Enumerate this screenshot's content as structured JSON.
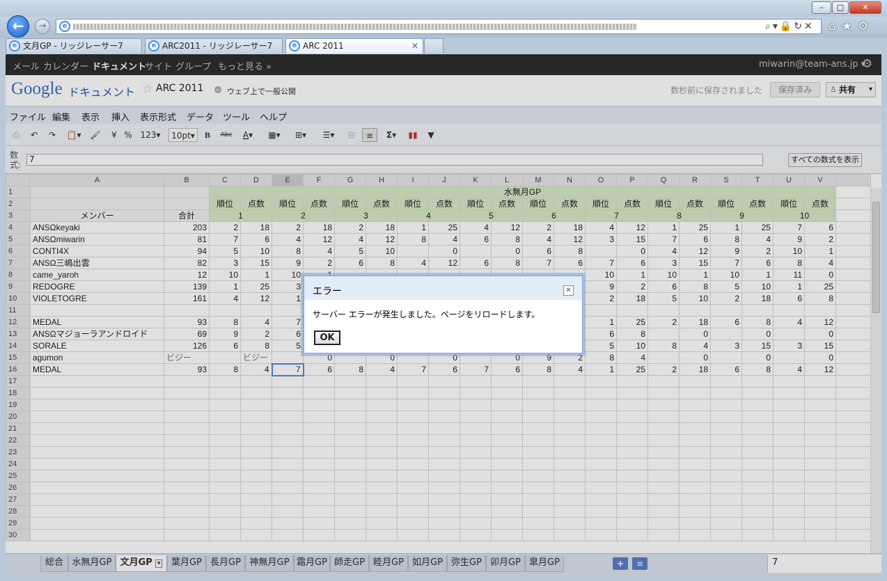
{
  "browser": {
    "tabs": [
      {
        "label": "文月GP - リッジレーサー7",
        "active": false
      },
      {
        "label": "ARC2011 - リッジレーサー7",
        "active": false
      },
      {
        "label": "ARC 2011",
        "active": true
      }
    ]
  },
  "gbar": {
    "items": [
      "メール",
      "カレンダー",
      "ドキュメント",
      "サイト",
      "グループ",
      "もっと見る »"
    ],
    "account": "miwarin@team-ans.jp ▾"
  },
  "header": {
    "logo": "Google",
    "product": "ドキュメント",
    "doc_title": "ARC 2011",
    "visibility": "ウェブ上で一般公開",
    "save_status": "数秒前に保存されました",
    "saved_button": "保存済み",
    "share_button": "共有"
  },
  "menu": [
    "ファイル",
    "編集",
    "表示",
    "挿入",
    "表示形式",
    "データ",
    "ツール",
    "ヘルプ"
  ],
  "toolbar": {
    "currency": "¥",
    "percent": "%",
    "format": "123",
    "font_size": "10pt",
    "bold": "B",
    "strike": "Abc"
  },
  "formula": {
    "label_line1": "数",
    "label_line2": "式:",
    "value": "7",
    "show_all_button": "すべての数式を表示"
  },
  "sheet": {
    "columns": [
      "A",
      "B",
      "C",
      "D",
      "E",
      "F",
      "G",
      "H",
      "I",
      "J",
      "K",
      "L",
      "M",
      "N",
      "O",
      "P",
      "Q",
      "R",
      "S",
      "T",
      "U",
      "V"
    ],
    "group_title": "水無月GP",
    "rank_label": "順位",
    "points_label": "点数",
    "round_numbers": [
      "1",
      "2",
      "3",
      "4",
      "5",
      "6",
      "7",
      "8",
      "9",
      "10"
    ],
    "member_header": "メンバー",
    "total_header": "合計",
    "rows": [
      {
        "n": "4",
        "name": "ANSΩkeyaki",
        "total": "203",
        "vals": [
          "2",
          "18",
          "2",
          "18",
          "2",
          "18",
          "1",
          "25",
          "4",
          "12",
          "2",
          "18",
          "4",
          "12",
          "1",
          "25",
          "1",
          "25",
          "7",
          "6"
        ]
      },
      {
        "n": "5",
        "name": "ANSΩmiwarin",
        "total": "81",
        "vals": [
          "7",
          "6",
          "4",
          "12",
          "4",
          "12",
          "8",
          "4",
          "6",
          "8",
          "4",
          "12",
          "3",
          "15",
          "7",
          "6",
          "8",
          "4",
          "9",
          "2"
        ]
      },
      {
        "n": "6",
        "name": "CONTI4X",
        "total": "94",
        "vals": [
          "5",
          "10",
          "8",
          "4",
          "5",
          "10",
          "",
          "0",
          "",
          "0",
          "6",
          "8",
          "",
          "0",
          "4",
          "12",
          "9",
          "2",
          "10",
          "1"
        ]
      },
      {
        "n": "7",
        "name": "ANSΩ三嶋出雲",
        "total": "82",
        "vals": [
          "3",
          "15",
          "9",
          "2",
          "6",
          "8",
          "4",
          "12",
          "6",
          "8",
          "7",
          "6",
          "7",
          "6",
          "3",
          "15",
          "7",
          "6",
          "8",
          "4"
        ]
      },
      {
        "n": "8",
        "name": "came_yaroh",
        "total": "12",
        "vals": [
          "10",
          "1",
          "10",
          "1",
          "",
          "",
          "",
          "",
          "",
          "",
          "",
          "",
          "10",
          "1",
          "10",
          "1",
          "10",
          "1",
          "11",
          "0"
        ]
      },
      {
        "n": "9",
        "name": "REDOGRE",
        "total": "139",
        "vals": [
          "1",
          "25",
          "3",
          "",
          "",
          "",
          "",
          "",
          "",
          "",
          "",
          "",
          "9",
          "2",
          "6",
          "8",
          "5",
          "10",
          "1",
          "25"
        ]
      },
      {
        "n": "10",
        "name": "VIOLETOGRE",
        "total": "161",
        "vals": [
          "4",
          "12",
          "1",
          "",
          "",
          "",
          "",
          "",
          "",
          "",
          "",
          "",
          "2",
          "18",
          "5",
          "10",
          "2",
          "18",
          "6",
          "8"
        ]
      },
      {
        "n": "11",
        "name": "",
        "total": "",
        "vals": [
          "",
          "",
          "",
          "",
          "",
          "",
          "",
          "",
          "",
          "",
          "",
          "",
          "",
          "",
          "",
          "",
          "",
          "",
          "",
          ""
        ]
      },
      {
        "n": "12",
        "name": "MEDAL",
        "total": "93",
        "vals": [
          "8",
          "4",
          "7",
          "",
          "",
          "",
          "",
          "",
          "",
          "",
          "",
          "",
          "1",
          "25",
          "2",
          "18",
          "6",
          "8",
          "4",
          "12"
        ]
      },
      {
        "n": "13",
        "name": "ANSΩマジョーラアンドロイド",
        "total": "69",
        "vals": [
          "9",
          "2",
          "6",
          "",
          "",
          "",
          "",
          "",
          "",
          "",
          "",
          "",
          "6",
          "8",
          "",
          "0",
          "",
          "0",
          "",
          "0"
        ]
      },
      {
        "n": "14",
        "name": "SORALE",
        "total": "126",
        "vals": [
          "6",
          "8",
          "5",
          "",
          "",
          "",
          "",
          "",
          "",
          "",
          "",
          "",
          "5",
          "10",
          "8",
          "4",
          "3",
          "15",
          "3",
          "15"
        ]
      },
      {
        "n": "15",
        "name": "agumon",
        "total": "ビジー",
        "vals": [
          "",
          "ビジー",
          "",
          "0",
          "",
          "0",
          "",
          "0",
          "",
          "0",
          "9",
          "2",
          "8",
          "4",
          "",
          "0",
          "",
          "0",
          "",
          "0"
        ]
      },
      {
        "n": "16",
        "name": "MEDAL",
        "total": "93",
        "vals": [
          "8",
          "4",
          "7",
          "6",
          "8",
          "4",
          "7",
          "6",
          "7",
          "6",
          "8",
          "4",
          "1",
          "25",
          "2",
          "18",
          "6",
          "8",
          "4",
          "12"
        ]
      }
    ],
    "empty_rows": [
      "17",
      "18",
      "19",
      "20",
      "21",
      "22",
      "23",
      "24",
      "25",
      "26",
      "27",
      "28",
      "29",
      "30"
    ]
  },
  "sheet_tabs": [
    "総合",
    "水無月GP",
    "文月GP",
    "葉月GP",
    "長月GP",
    "神無月GP",
    "霜月GP",
    "師走GP",
    "睦月GP",
    "如月GP",
    "弥生GP",
    "卯月GP",
    "皐月GP"
  ],
  "status_cell_value": "7",
  "dialog": {
    "title": "エラー",
    "message": "サーバー エラーが発生しました。ページをリロードします。",
    "ok": "OK"
  }
}
